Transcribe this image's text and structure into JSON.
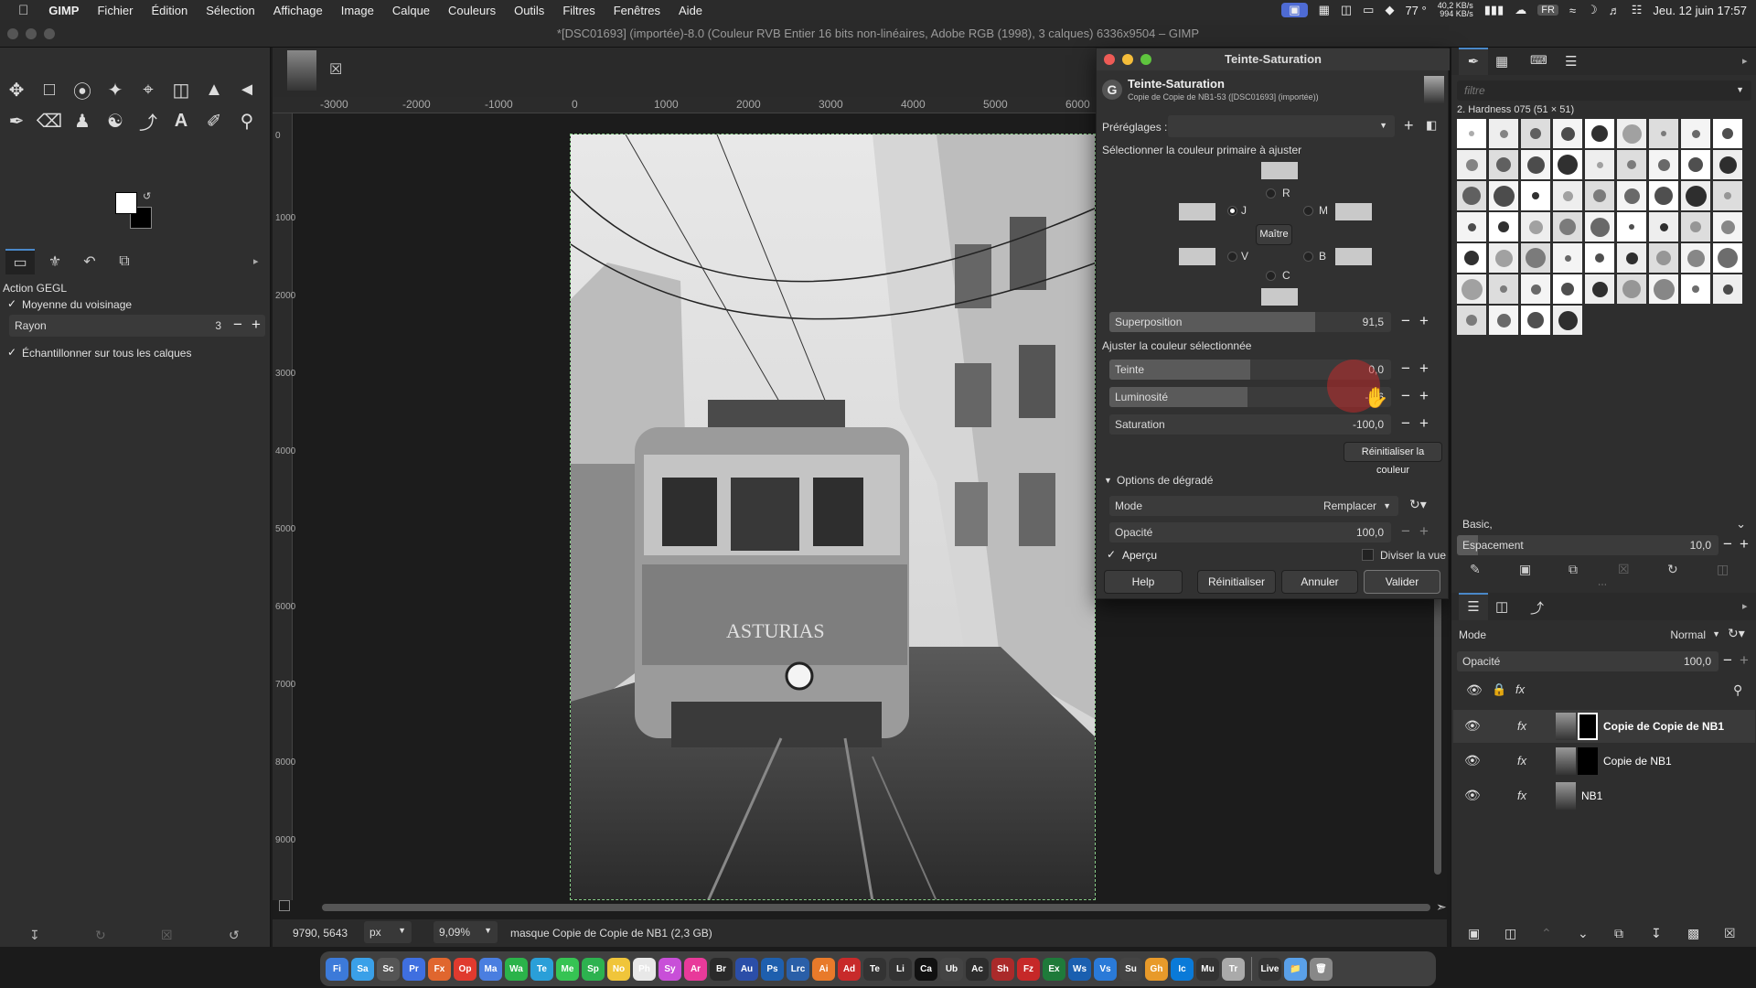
{
  "menubar": {
    "app": "GIMP",
    "items": [
      "Fichier",
      "Édition",
      "Sélection",
      "Affichage",
      "Image",
      "Calque",
      "Couleurs",
      "Outils",
      "Filtres",
      "Fenêtres",
      "Aide"
    ],
    "temp": "77 °",
    "net_up": "40,2 KB/s",
    "net_down": "994 KB/s",
    "lang": "FR",
    "datetime": "Jeu. 12 juin  17:57"
  },
  "window": {
    "title": "*[DSC01693] (importée)-8.0 (Couleur RVB Entier 16 bits non-linéaires, Adobe RGB (1998), 3 calques) 6336x9504 – GIMP"
  },
  "tool_options": {
    "title": "Action GEGL",
    "opt1": "Moyenne du voisinage",
    "rayon_label": "Rayon",
    "rayon_value": "3",
    "opt2": "Échantillonner sur tous les calques"
  },
  "rulers": {
    "h": [
      "-3000",
      "-2000",
      "-1000",
      "0",
      "1000",
      "2000",
      "3000",
      "4000",
      "5000",
      "6000"
    ],
    "v": [
      "0",
      "1000",
      "2000",
      "3000",
      "4000",
      "5000",
      "6000",
      "7000",
      "8000",
      "9000"
    ]
  },
  "statusbar": {
    "coords": "9790, 5643",
    "unit": "px",
    "zoom": "9,09%",
    "message": "masque Copie de Copie de NB1 (2,3 GB)"
  },
  "dialog": {
    "title": "Teinte-Saturation",
    "heading": "Teinte-Saturation",
    "subheading": "Copie de Copie de NB1-53 ([DSC01693] (importée))",
    "presets_label": "Préréglages :",
    "select_label": "Sélectionner la couleur primaire à ajuster",
    "r": "R",
    "y": "J",
    "m": "M",
    "master": "Maître",
    "g": "V",
    "b": "B",
    "c": "C",
    "overlap_label": "Superposition",
    "overlap_value": "91,5",
    "overlap_frac": 0.73,
    "adjust_label": "Ajuster la couleur sélectionnée",
    "hue_label": "Teinte",
    "hue_value": "0,0",
    "hue_frac": 0.5,
    "light_label": "Luminosité",
    "light_value": "-2,6",
    "light_frac": 0.49,
    "sat_label": "Saturation",
    "sat_value": "-100,0",
    "sat_frac": 0.0,
    "reset_color": "Réinitialiser la couleur",
    "blend_label": "Options de dégradé",
    "mode_label": "Mode",
    "mode_value": "Remplacer",
    "opacity_label": "Opacité",
    "opacity_value": "100,0",
    "preview": "Aperçu",
    "split": "Diviser la vue",
    "btn_help": "Help",
    "btn_reset": "Réinitialiser",
    "btn_cancel": "Annuler",
    "btn_ok": "Valider"
  },
  "brushes": {
    "filter_placeholder": "filtre",
    "current": "2. Hardness 075 (51 × 51)",
    "preset": "Basic,",
    "spacing_label": "Espacement",
    "spacing_value": "10,0"
  },
  "layers": {
    "mode_label": "Mode",
    "mode_value": "Normal",
    "opacity_label": "Opacité",
    "opacity_value": "100,0",
    "items": [
      {
        "name": "Copie de Copie de NB1"
      },
      {
        "name": "Copie de NB1"
      },
      {
        "name": "NB1"
      }
    ]
  },
  "dock": [
    "Fi",
    "Sa",
    "Sc",
    "Pr",
    "Fx",
    "Op",
    "Ma",
    "Wa",
    "Te",
    "Me",
    "Sp",
    "No",
    "Ph",
    "Sy",
    "Ar",
    "Br",
    "Au",
    "Ps",
    "Lrc",
    "Ai",
    "Ad",
    "Te",
    "Li",
    "Ca",
    "Ub",
    "Ac",
    "Sh",
    "Fz",
    "Ex",
    "Ws",
    "Vs",
    "Su",
    "Gh",
    "Ic",
    "Mu",
    "Tr"
  ],
  "dock_tray": [
    "Live"
  ]
}
